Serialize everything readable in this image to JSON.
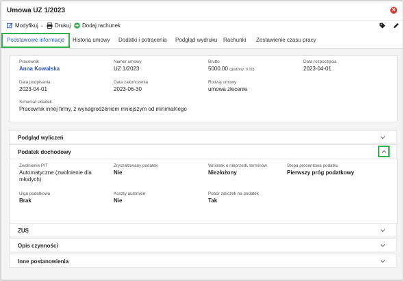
{
  "window": {
    "title": "Umowa UZ 1/2023"
  },
  "toolbar": {
    "modify_label": "Modyfikuj",
    "print_label": "Drukuj",
    "add_bill_label": "Dodaj rachunek"
  },
  "tabs": [
    {
      "label": "Podstawowe informacje"
    },
    {
      "label": "Historia umowy"
    },
    {
      "label": "Dodatki i potrącenia"
    },
    {
      "label": "Podgląd wydruku"
    },
    {
      "label": "Rachunki"
    },
    {
      "label": "Zestawienie czasu pracy"
    }
  ],
  "basic": {
    "employee_label": "Pracownik",
    "employee_value": "Anna Kowalska",
    "number_label": "Numer umowy",
    "number_value": "UZ 1/2023",
    "gross_label": "Brutto",
    "gross_value": "5000.00",
    "gross_hours": "(godziny: 0.00)",
    "start_label": "Data rozpoczęcia",
    "start_value": "2023-04-01",
    "signed_label": "Data podpisania",
    "signed_value": "2023-04-01",
    "end_label": "Data zakończenia",
    "end_value": "2023-06-30",
    "type_label": "Rodzaj umowy",
    "type_value": "umowa zlecenie",
    "scheme_label": "Schemat składek",
    "scheme_value": "Pracownik innej firmy, z wynagrodzeniem mniejszym od minimalnego"
  },
  "sections": {
    "preview": "Podgląd wyliczeń",
    "tax": "Podatek dochodowy",
    "zus": "ZUS",
    "description": "Opis czynności",
    "other": "Inne postanowienia"
  },
  "tax": {
    "exempt_label": "Zwolnienie PIT",
    "exempt_value": "Automatyczne (zwolnienie dla młodych)",
    "flat_label": "Zryczałtowany podatek",
    "flat_value": "Nie",
    "request_label": "Wniosek o nieprzedł. terminów",
    "request_value": "Niezłożony",
    "rate_label": "Stopa procentowa podatku",
    "rate_value": "Pierwszy próg podatkowy",
    "relief_label": "Ulga podatkowa",
    "relief_value": "Brak",
    "costs_label": "Koszty autorskie",
    "costs_value": "Nie",
    "advance_label": "Pobór zaliczek na podatek",
    "advance_value": "Tak"
  },
  "colors": {
    "accent_green": "#2fb24b",
    "link_blue": "#2b57b6",
    "close_red": "#d9342b"
  }
}
